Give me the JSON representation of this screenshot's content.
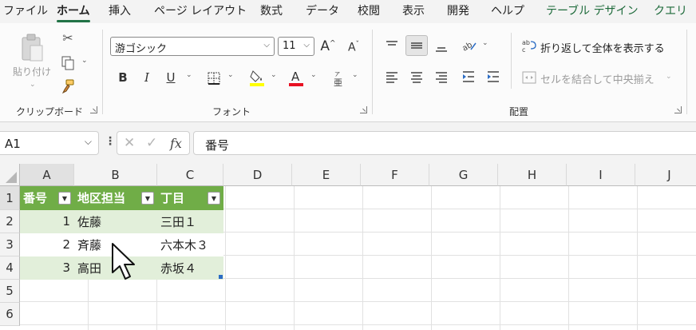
{
  "menu": {
    "tabs": [
      "ファイル",
      "ホーム",
      "挿入",
      "ページ レイアウト",
      "数式",
      "データ",
      "校閲",
      "表示",
      "開発",
      "ヘルプ",
      "テーブル デザイン",
      "クエリ"
    ],
    "active": "ホーム"
  },
  "ribbon": {
    "clipboard": {
      "paste_label": "貼り付け",
      "group_label": "クリップボード"
    },
    "font": {
      "font_name": "游ゴシック",
      "font_size": "11",
      "group_label": "フォント",
      "bold": "B",
      "italic": "I",
      "underline": "U"
    },
    "alignment": {
      "wrap_text": "折り返して全体を表示する",
      "merge_center": "セルを結合して中央揃え",
      "group_label": "配置"
    }
  },
  "formula_bar": {
    "name_box": "A1",
    "fx_label": "fx",
    "content": "番号"
  },
  "grid": {
    "columns": [
      "A",
      "B",
      "C",
      "D",
      "E",
      "F",
      "G",
      "H",
      "I",
      "J"
    ],
    "rows": [
      "1",
      "2",
      "3",
      "4",
      "5",
      "6"
    ],
    "table": {
      "headers": [
        "番号",
        "地区担当",
        "丁目"
      ],
      "rows": [
        {
          "a": "1",
          "b": "佐藤",
          "c": "三田１"
        },
        {
          "a": "2",
          "b": "斉藤",
          "c": "六本木３"
        },
        {
          "a": "3",
          "b": "高田",
          "c": "赤坂４"
        }
      ]
    }
  },
  "colors": {
    "accent": "#217346",
    "table_header": "#70ad47",
    "table_band": "#e2efda",
    "font_color": "#e81123",
    "highlight": "#ffff00"
  }
}
